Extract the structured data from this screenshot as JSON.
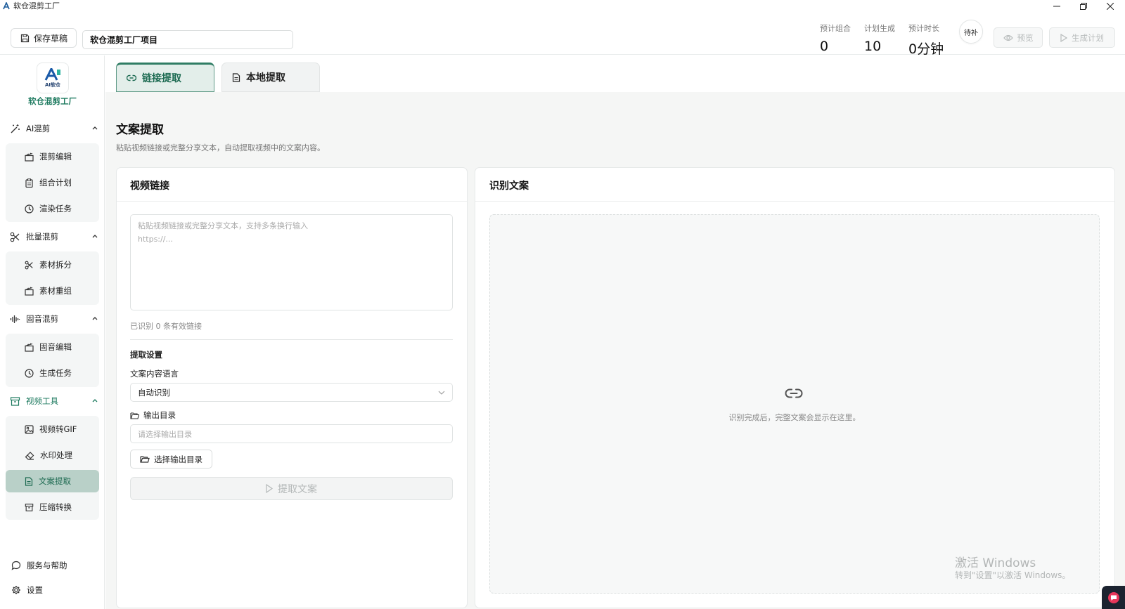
{
  "window": {
    "title": "软仓混剪工厂"
  },
  "header": {
    "save_label": "保存草稿",
    "project_name": "软仓混剪工厂项目",
    "stats": [
      {
        "label": "预计组合",
        "value": "0"
      },
      {
        "label": "计划生成",
        "value": "10"
      },
      {
        "label": "预计时长",
        "value": "0分钟"
      }
    ],
    "status": "待补",
    "preview_label": "预览",
    "generate_label": "生成计划"
  },
  "sidebar": {
    "logo_text": "AI软仓",
    "brand": "软仓混剪工厂",
    "groups": [
      {
        "label": "AI混剪",
        "icon": "magic-wand-icon",
        "items": [
          {
            "label": "混剪编辑",
            "icon": "clapperboard-icon"
          },
          {
            "label": "组合计划",
            "icon": "clipboard-icon"
          },
          {
            "label": "渲染任务",
            "icon": "clock-icon"
          }
        ]
      },
      {
        "label": "批量混剪",
        "icon": "scissors-icon",
        "items": [
          {
            "label": "素材拆分",
            "icon": "scissors-icon"
          },
          {
            "label": "素材重组",
            "icon": "clapperboard-icon"
          }
        ]
      },
      {
        "label": "固音混剪",
        "icon": "audio-wave-icon",
        "items": [
          {
            "label": "固音编辑",
            "icon": "clapperboard-icon"
          },
          {
            "label": "生成任务",
            "icon": "clock-icon"
          }
        ]
      },
      {
        "label": "视频工具",
        "icon": "archive-icon",
        "items": [
          {
            "label": "视频转GIF",
            "icon": "image-icon"
          },
          {
            "label": "水印处理",
            "icon": "eraser-icon"
          },
          {
            "label": "文案提取",
            "icon": "document-icon",
            "active": true
          },
          {
            "label": "压缩转换",
            "icon": "archive-icon"
          }
        ]
      }
    ],
    "footer": [
      {
        "label": "服务与帮助",
        "icon": "chat-bubble-icon"
      },
      {
        "label": "设置",
        "icon": "gear-icon"
      }
    ]
  },
  "tabs": [
    {
      "label": "链接提取",
      "icon": "link-icon",
      "active": true
    },
    {
      "label": "本地提取",
      "icon": "file-icon"
    }
  ],
  "main": {
    "title": "文案提取",
    "description": "粘贴视频链接或完整分享文本，自动提取视频中的文案内容。"
  },
  "left_card": {
    "title": "视频链接",
    "placeholder_line1": "粘贴视频链接或完整分享文本，支持多条换行输入",
    "placeholder_line2": "https://...",
    "detected": "已识别 0 条有效链接",
    "settings_title": "提取设置",
    "language_label": "文案内容语言",
    "language_value": "自动识别",
    "output_label": "输出目录",
    "output_placeholder": "请选择输出目录",
    "choose_dir_label": "选择输出目录",
    "extract_label": "提取文案"
  },
  "right_card": {
    "title": "识别文案",
    "empty_text": "识别完成后，完整文案会显示在这里。"
  },
  "watermark": {
    "line1": "激活 Windows",
    "line2": "转到\"设置\"以激活 Windows。"
  },
  "colors": {
    "accent": "#2f7d64",
    "active_bg": "#b9d0c8",
    "tab_bg": "#e3eeea"
  }
}
